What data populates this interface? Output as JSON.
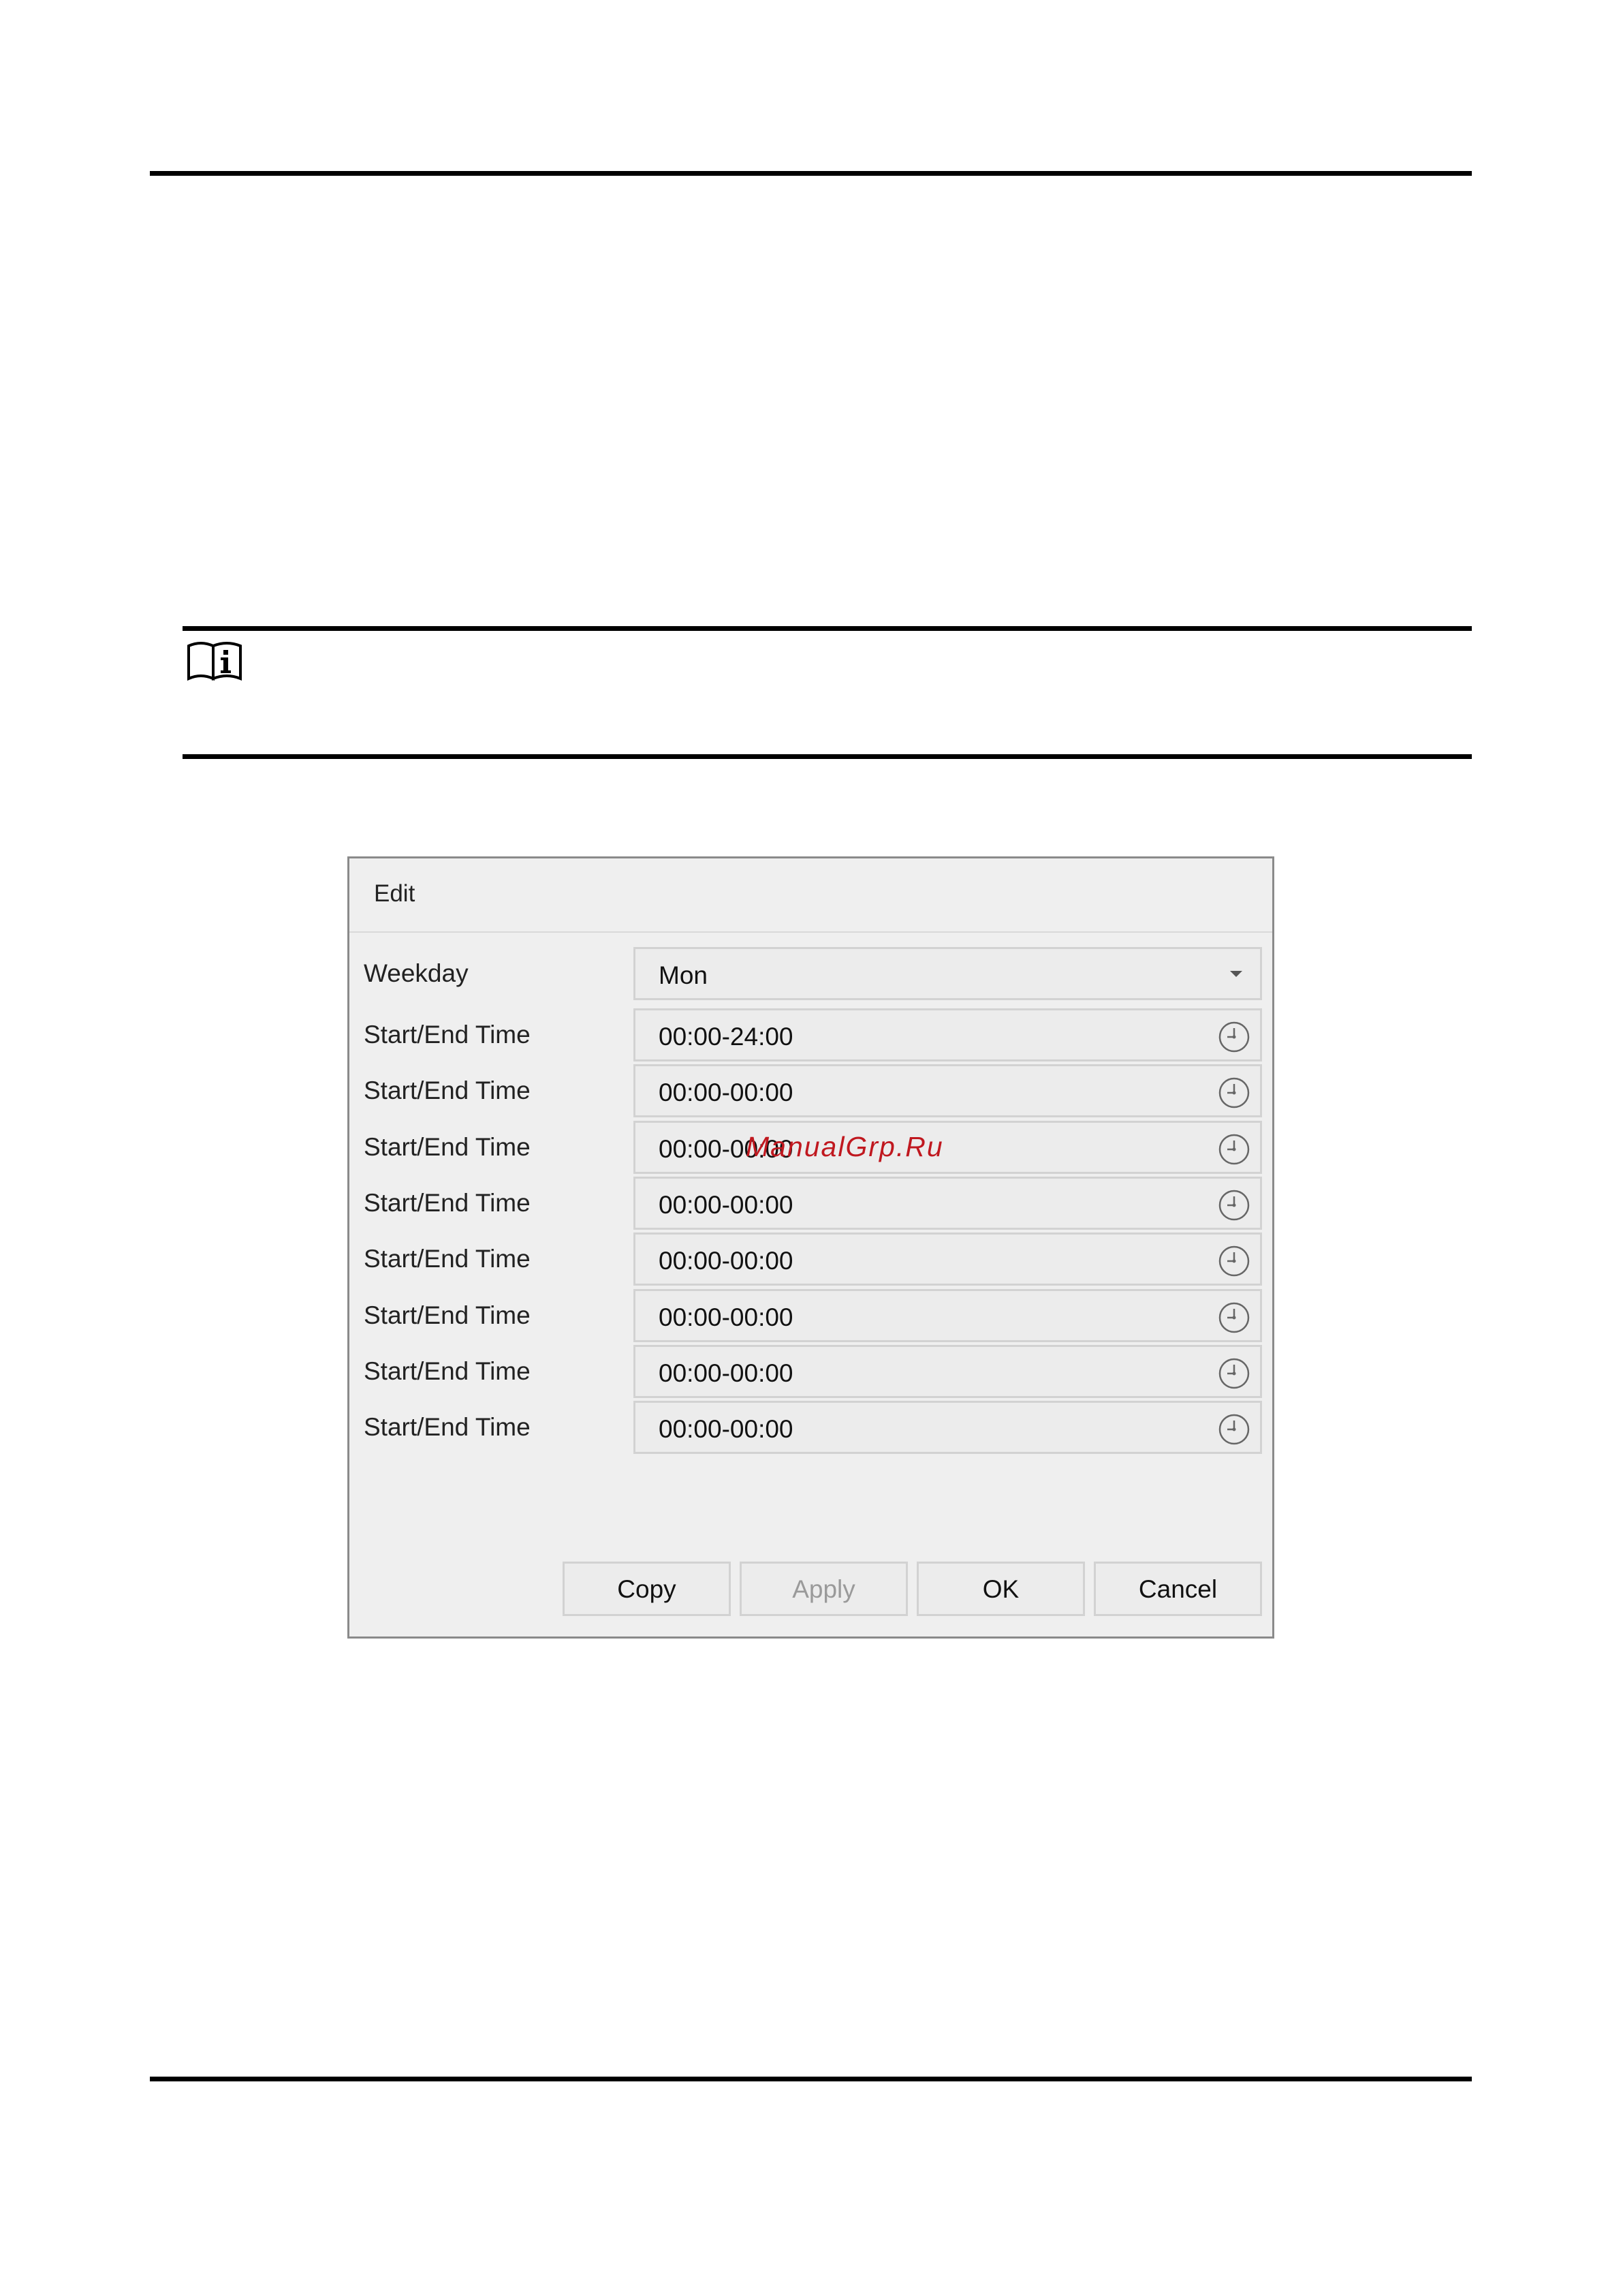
{
  "dialog": {
    "title": "Edit",
    "weekday": {
      "label": "Weekday",
      "value": "Mon"
    },
    "time_rows": [
      {
        "label": "Start/End Time",
        "value": "00:00-24:00"
      },
      {
        "label": "Start/End Time",
        "value": "00:00-00:00"
      },
      {
        "label": "Start/End Time",
        "value": "00:00-00:00"
      },
      {
        "label": "Start/End Time",
        "value": "00:00-00:00"
      },
      {
        "label": "Start/End Time",
        "value": "00:00-00:00"
      },
      {
        "label": "Start/End Time",
        "value": "00:00-00:00"
      },
      {
        "label": "Start/End Time",
        "value": "00:00-00:00"
      },
      {
        "label": "Start/End Time",
        "value": "00:00-00:00"
      }
    ],
    "buttons": {
      "copy": "Copy",
      "apply": "Apply",
      "ok": "OK",
      "cancel": "Cancel"
    }
  },
  "watermark": "ManualGrp.Ru",
  "icons": {
    "note": "info-book-icon",
    "dropdown": "chevron-down-icon",
    "time": "clock-icon"
  },
  "colors": {
    "dialog_bg": "#efefef",
    "field_bg": "#ececec",
    "watermark": "#c0181f"
  }
}
